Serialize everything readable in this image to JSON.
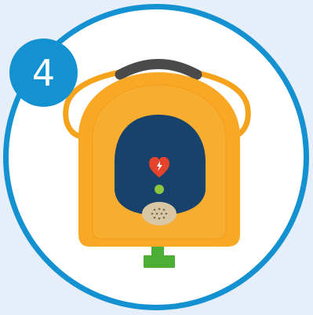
{
  "step": {
    "number": "4"
  },
  "colors": {
    "background": "#e6eef9",
    "ring": "#1491d1",
    "badge": "#1491d1",
    "device_body": "#f9a825",
    "device_body_dark": "#f5a31a",
    "screen": "#16426b",
    "handle": "#4a4a4a",
    "heart": "#e5432b",
    "indicator_light": "#8cc63f",
    "speaker": "#d9c6a5",
    "connector": "#4caf35"
  },
  "icons": {
    "badge": "step-number-badge",
    "device": "defibrillator-icon",
    "shock_button": "heart-lightning-icon",
    "status_light": "status-light-icon",
    "speaker": "speaker-grille-icon",
    "connector": "pad-connector-icon"
  }
}
